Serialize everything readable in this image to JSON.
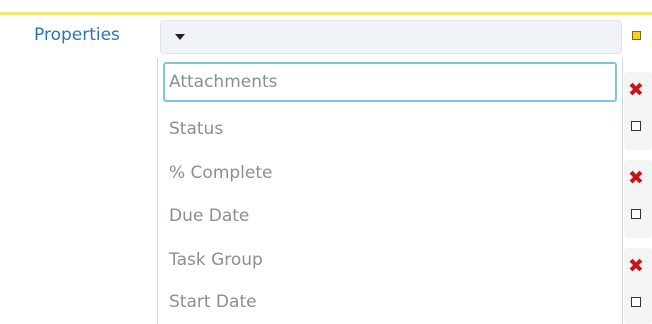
{
  "field": {
    "label": "Properties"
  },
  "dropdown": {
    "options": [
      {
        "label": "Attachments"
      },
      {
        "label": "Status"
      },
      {
        "label": "% Complete"
      },
      {
        "label": "Due Date"
      },
      {
        "label": "Task Group"
      },
      {
        "label": "Start Date"
      }
    ]
  },
  "colors": {
    "label_text": "#2c74b3",
    "option_text": "#8a8f93",
    "focus_outline": "#7fc4da",
    "top_rule": "#f8e27a",
    "required_marker": "#f7d31b",
    "delete_icon": "#c81414"
  },
  "icons": {
    "caret": "caret-down-icon",
    "delete": "delete-icon",
    "required": "required-marker-icon",
    "checkbox": "checkbox-icon"
  }
}
